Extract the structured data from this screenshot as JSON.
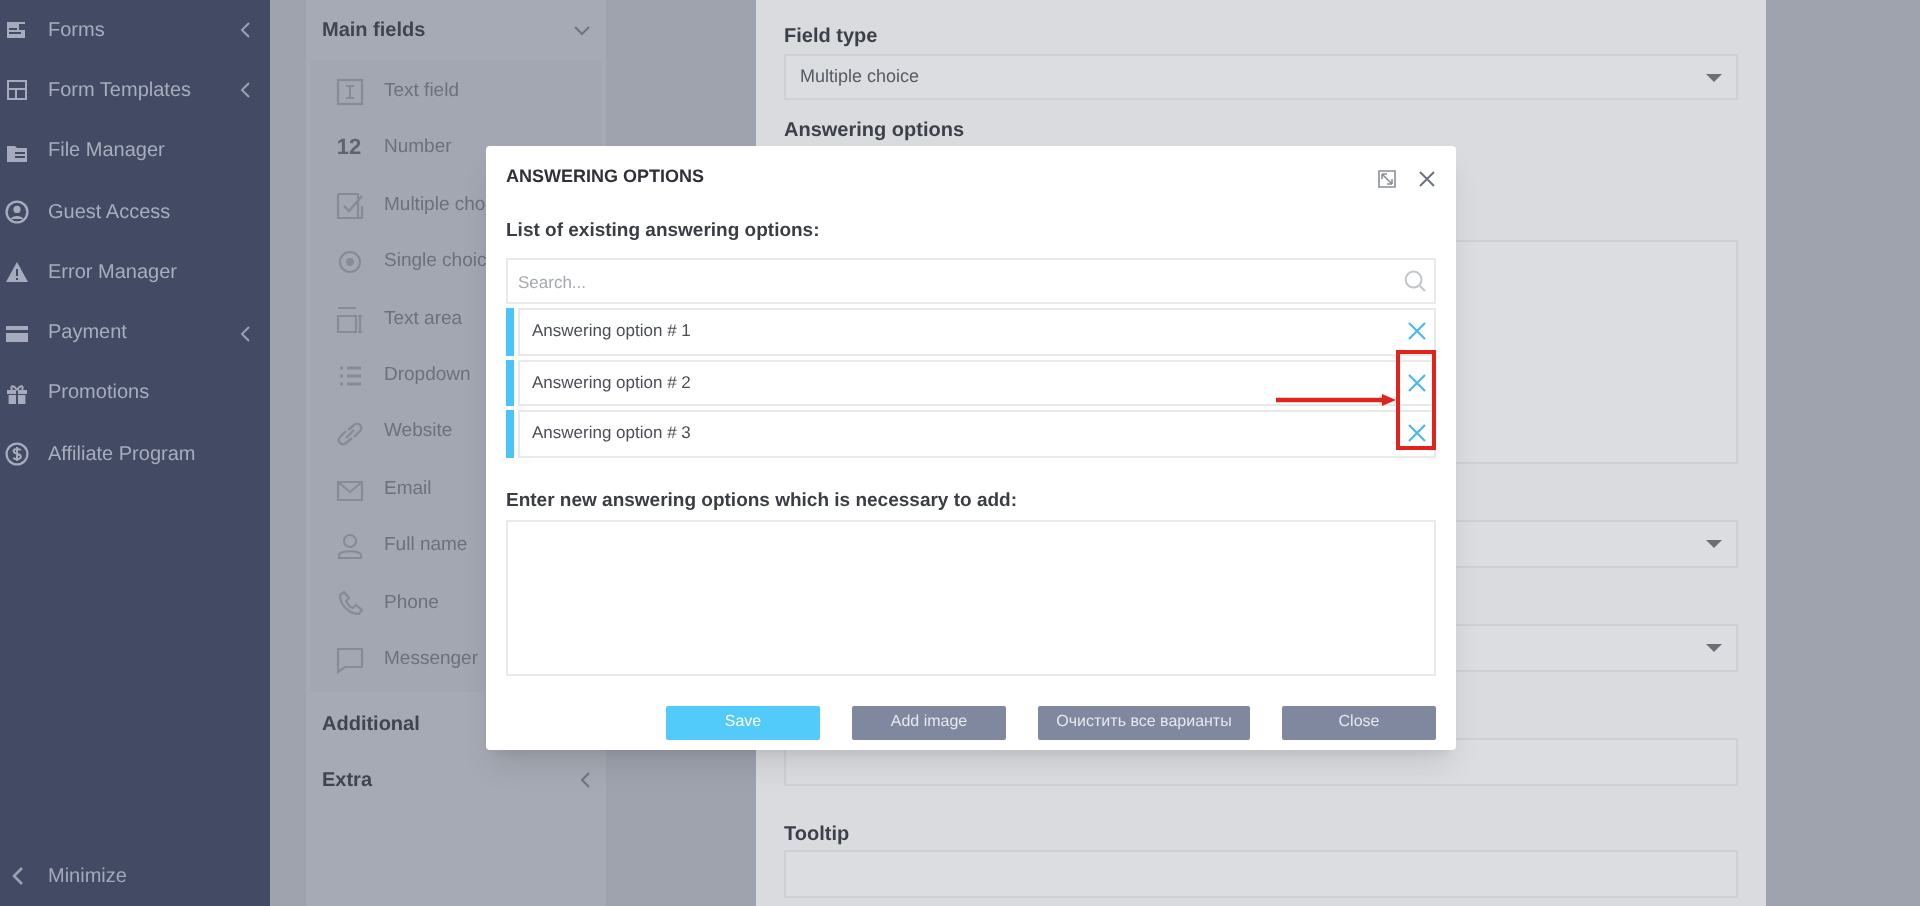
{
  "sidebar": {
    "items": [
      {
        "label": "Forms",
        "expandable": true
      },
      {
        "label": "Form Templates",
        "expandable": true
      },
      {
        "label": "File Manager",
        "expandable": false
      },
      {
        "label": "Guest Access",
        "expandable": false
      },
      {
        "label": "Error Manager",
        "expandable": false
      },
      {
        "label": "Payment",
        "expandable": true
      },
      {
        "label": "Promotions",
        "expandable": false
      },
      {
        "label": "Affiliate Program",
        "expandable": false
      }
    ],
    "minimize": "Minimize"
  },
  "field_panel": {
    "sections": [
      {
        "title": "Main fields",
        "expanded": true,
        "items": [
          {
            "label": "Text field"
          },
          {
            "label": "Number",
            "icon_text": "12"
          },
          {
            "label": "Multiple cho"
          },
          {
            "label": "Single choic"
          },
          {
            "label": "Text area"
          },
          {
            "label": "Dropdown"
          },
          {
            "label": "Website"
          },
          {
            "label": "Email"
          },
          {
            "label": "Full name"
          },
          {
            "label": "Phone"
          },
          {
            "label": "Messenger"
          }
        ]
      },
      {
        "title": "Additional"
      },
      {
        "title": "Extra",
        "expanded": false
      }
    ]
  },
  "form": {
    "field_type_label": "Field type",
    "field_type_value": "Multiple choice",
    "answering_options_label": "Answering options",
    "tooltip_label": "Tooltip"
  },
  "modal": {
    "title": "ANSWERING OPTIONS",
    "list_label": "List of existing answering options:",
    "search_placeholder": "Search...",
    "options": [
      {
        "label": "Answering option # 1"
      },
      {
        "label": "Answering option # 2"
      },
      {
        "label": "Answering option # 3"
      }
    ],
    "new_label": "Enter new answering options which is necessary to add:",
    "buttons": [
      {
        "label": "Save",
        "kind": "primary"
      },
      {
        "label": "Add image",
        "kind": "secondary"
      },
      {
        "label": "Очистить все варианты",
        "kind": "secondary"
      },
      {
        "label": "Close",
        "kind": "secondary"
      }
    ]
  }
}
